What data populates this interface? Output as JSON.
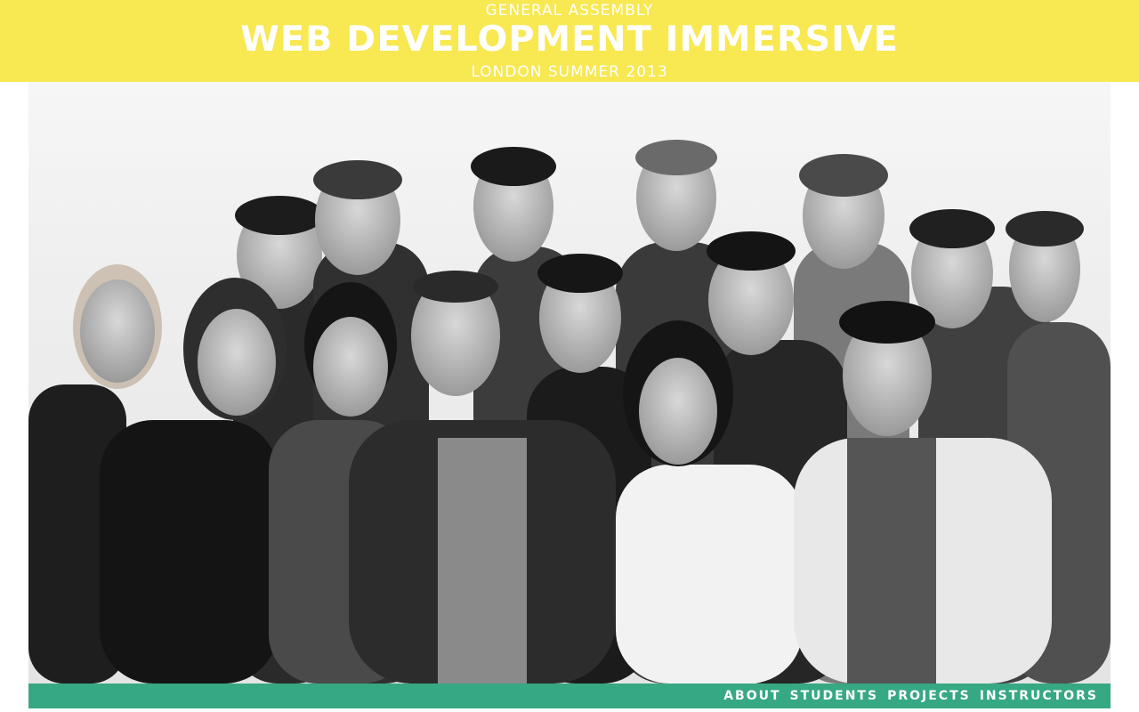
{
  "header": {
    "kicker": "GENERAL ASSEMBLY",
    "title": "WEB DEVELOPMENT IMMERSIVE",
    "subtitle": "LONDON SUMMER 2013"
  },
  "photo": {
    "description_icon": "group-photo-icon"
  },
  "nav": {
    "items": [
      {
        "label": "ABOUT"
      },
      {
        "label": "STUDENTS"
      },
      {
        "label": "PROJECTS"
      },
      {
        "label": "INSTRUCTORS"
      }
    ]
  },
  "colors": {
    "header_bg": "#f8e852",
    "nav_bg": "#36a883",
    "text": "#ffffff"
  }
}
